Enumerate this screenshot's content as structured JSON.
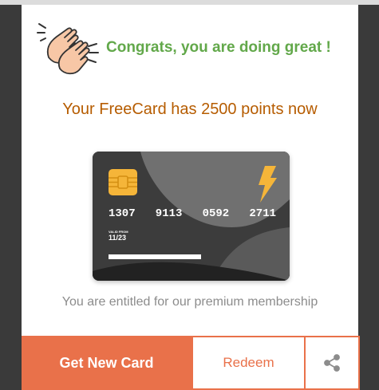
{
  "header": {
    "clap_icon": "clapping-hands-icon",
    "congrats_text": "Congrats, you are doing great !"
  },
  "points_message": "Your FreeCard has 2500 points now",
  "card": {
    "number_groups": [
      "1307",
      "9113",
      "0592",
      "2711"
    ],
    "valid_label": "VALID FROM",
    "valid_date": "11/23",
    "chip_icon": "chip-icon",
    "brand_icon": "lightning-bolt-icon"
  },
  "membership_message": "You are entitled for our premium membership",
  "actions": {
    "primary_label": "Get New Card",
    "secondary_label": "Redeem",
    "share_icon": "share-icon"
  },
  "colors": {
    "congrats": "#62a84a",
    "points": "#b65c00",
    "accent": "#e9714a",
    "card_dark": "#3c3c3c",
    "chip": "#f5b539"
  }
}
